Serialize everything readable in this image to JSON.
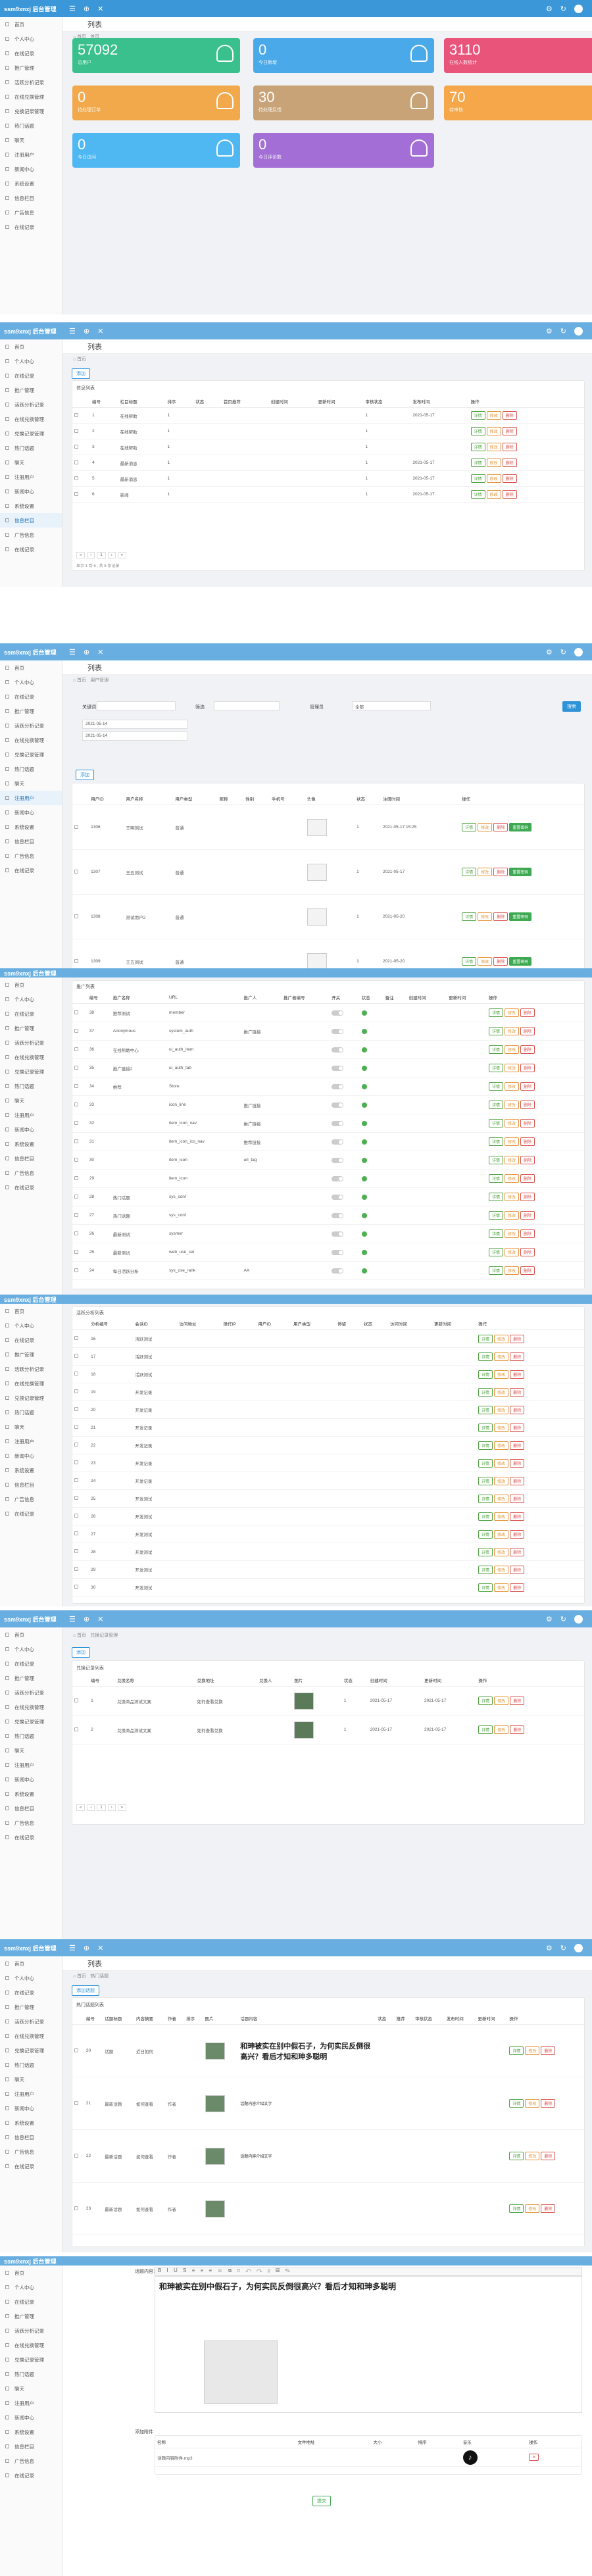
{
  "app": {
    "logo": "ssm9xnxj 后台管理"
  },
  "sidebar": [
    "首页",
    "个人中心",
    "在线记录",
    "推广管理",
    "活跃分析记录",
    "在线兑换管理",
    "兑换记录管理",
    "热门话题",
    "聊天",
    "注册用户",
    "新闻中心",
    "系统设置",
    "信息栏目",
    "广告信息",
    "在线记录"
  ],
  "s1": {
    "title": "列表",
    "crumb1": "⌂ 首页",
    "crumb2": "首页",
    "cards": [
      {
        "num": "57092",
        "label": "总用户",
        "color": "#39c08c"
      },
      {
        "num": "0",
        "label": "今日新增",
        "color": "#4aa9e8"
      },
      {
        "num": "3110",
        "label": "在线人数统计",
        "color": "#e9547a"
      },
      {
        "num": "0",
        "label": "待处理订单",
        "color": "#f1a94c"
      },
      {
        "num": "30",
        "label": "待处理反馈",
        "color": "#c7a377"
      },
      {
        "num": "70",
        "label": "待审核",
        "color": "#f5a74a"
      },
      {
        "num": "0",
        "label": "今日访问",
        "color": "#4fb7f2"
      },
      {
        "num": "0",
        "label": "今日评论数",
        "color": "#a36fd6"
      }
    ]
  },
  "s2": {
    "title": "列表",
    "add": "添加",
    "section": "信息列表",
    "headers": [
      "",
      "编号",
      "栏目标题",
      "排序",
      "状态",
      "首页推荐",
      "创建时间",
      "更新时间",
      "审核状态",
      "发布时间",
      "操作"
    ],
    "rows": [
      [
        "1",
        "在线帮助",
        "1",
        "",
        "1",
        "2021-05-17"
      ],
      [
        "2",
        "在线帮助",
        "1",
        "",
        "1",
        ""
      ],
      [
        "3",
        "在线帮助",
        "1",
        "",
        "1",
        ""
      ],
      [
        "4",
        "最新消息",
        "1",
        "",
        "1",
        "2021-05-17"
      ],
      [
        "5",
        "最新消息",
        "1",
        "",
        "1",
        "2021-05-17"
      ],
      [
        "6",
        "新闻",
        "1",
        "",
        "1",
        "2021-05-17"
      ]
    ],
    "info": "显示 1 到 6 , 共 6 条记录"
  },
  "s3": {
    "title": "列表",
    "crumb2": "用户管理",
    "kw": "关键词",
    "filter": "筛选",
    "search": "搜索",
    "sel": "全部",
    "d1": "2021-05-14",
    "d2": "2021-05-14",
    "tag": "管理员",
    "headers": [
      "",
      "用户ID",
      "用户名称",
      "用户类型",
      "昵称",
      "性别",
      "手机号",
      "头像",
      "状态",
      "注册时间",
      "操作"
    ],
    "rows": [
      [
        "1306",
        "王明测试",
        "普通",
        "1",
        "2021-05-17 15:25"
      ],
      [
        "1307",
        "王五测试",
        "普通",
        "1",
        "2021-05-17"
      ],
      [
        "1308",
        "测试用户2",
        "普通",
        "1",
        "2021-05-20"
      ],
      [
        "1309",
        "王五测试",
        "普通",
        "1",
        "2021-05-20"
      ]
    ]
  },
  "s4": {
    "section": "推广列表",
    "headers": [
      "",
      "编号",
      "推广名称",
      "URL",
      "推广人",
      "推广者编号",
      "开关",
      "状态",
      "备注",
      "创建时间",
      "更新时间",
      "操作"
    ],
    "rows": [
      [
        "38",
        "推荐测试",
        "member",
        ""
      ],
      [
        "37",
        "Anonymous",
        "system_auth",
        "推广链接"
      ],
      [
        "36",
        "在线帮助中心",
        "ui_auth_item",
        ""
      ],
      [
        "35",
        "推广链接2",
        "ui_auth_tab",
        ""
      ],
      [
        "34",
        "推荐",
        "Store",
        ""
      ],
      [
        "33",
        "",
        "icon_line",
        "推广链接"
      ],
      [
        "32",
        "",
        "item_icon_nav",
        "推广链接"
      ],
      [
        "31",
        "",
        "item_icon_ico_nav",
        "推荐链接"
      ],
      [
        "30",
        "",
        "item_icon",
        "url_tag"
      ],
      [
        "29",
        "",
        "item_icon",
        ""
      ],
      [
        "28",
        "热门话题",
        "sys_conf",
        ""
      ],
      [
        "27",
        "热门话题",
        "sys_conf",
        ""
      ],
      [
        "26",
        "最新测试",
        "sysmer",
        ""
      ],
      [
        "25",
        "最新测试",
        "web_use_set",
        ""
      ],
      [
        "24",
        "每日活跃分析",
        "sys_use_rank",
        "AA"
      ]
    ]
  },
  "s5": {
    "section": "活跃分析列表",
    "headers": [
      "",
      "分析编号",
      "会话ID",
      "访问地址",
      "操作IP",
      "用户ID",
      "用户类型",
      "停留",
      "状态",
      "访问时间",
      "更新时间",
      "操作"
    ],
    "rows": [
      [
        "16",
        "活跃测试"
      ],
      [
        "17",
        "活跃测试"
      ],
      [
        "18",
        "活跃测试"
      ],
      [
        "19",
        "开发记录"
      ],
      [
        "20",
        "开发记录"
      ],
      [
        "21",
        "开发记录"
      ],
      [
        "22",
        "开发记录"
      ],
      [
        "23",
        "开发记录"
      ],
      [
        "24",
        "开发记录"
      ],
      [
        "25",
        "开发测试"
      ],
      [
        "26",
        "开发测试"
      ],
      [
        "27",
        "开发测试"
      ],
      [
        "28",
        "开发测试"
      ],
      [
        "29",
        "开发测试"
      ],
      [
        "30",
        "开发测试"
      ]
    ]
  },
  "s6": {
    "crumb2": "兑换记录管理",
    "add": "添加",
    "section": "兑换记录列表",
    "headers": [
      "",
      "编号",
      "兑换名称",
      "兑换地址",
      "兑换人",
      "图片",
      "状态",
      "创建时间",
      "更新时间",
      "操作"
    ],
    "rows": [
      [
        "1",
        "兑换商品测试文案",
        "如何查看兑换",
        "1",
        "2021-05-17",
        "2021-05-17"
      ],
      [
        "2",
        "兑换商品测试文案",
        "如何查看兑换",
        "1",
        "2021-05-17",
        "2021-05-17"
      ]
    ]
  },
  "s7": {
    "title": "列表",
    "crumb2": "热门话题",
    "add": "添加话题",
    "section": "热门话题列表",
    "headers": [
      "",
      "编号",
      "话题标题",
      "内容摘要",
      "作者",
      "排序",
      "图片",
      "话题内容",
      "状态",
      "推荐",
      "审核状态",
      "发布时间",
      "更新时间",
      "操作"
    ],
    "rows": [
      [
        "20",
        "话题",
        "近日如何",
        "",
        "和珅被实在别中假石子，为何实民反倒很高兴？看后才知和珅多聪明"
      ],
      [
        "21",
        "最新话题",
        "如何查看",
        "作者",
        "话题内容介绍文字"
      ],
      [
        "22",
        "最新话题",
        "如何查看",
        "作者",
        "话题内容介绍文字"
      ],
      [
        "23",
        "最新话题",
        "如何查看",
        "作者",
        ""
      ]
    ],
    "big": "和珅被实在别中假石子，为何实民反倒很高兴？看后才知和珅多聪明"
  },
  "s8": {
    "label_title": "标题：",
    "label_content": "话题内容：",
    "heading": "和珅被实在别中假石子，为何实民反倒很高兴？看后才知和珅多聪明",
    "attach": "添加附件",
    "headers": [
      "名称",
      "文件地址",
      "大小",
      "排序",
      "音乐",
      "操作"
    ],
    "row": "话题内容附件.mp3",
    "save": "提交"
  }
}
